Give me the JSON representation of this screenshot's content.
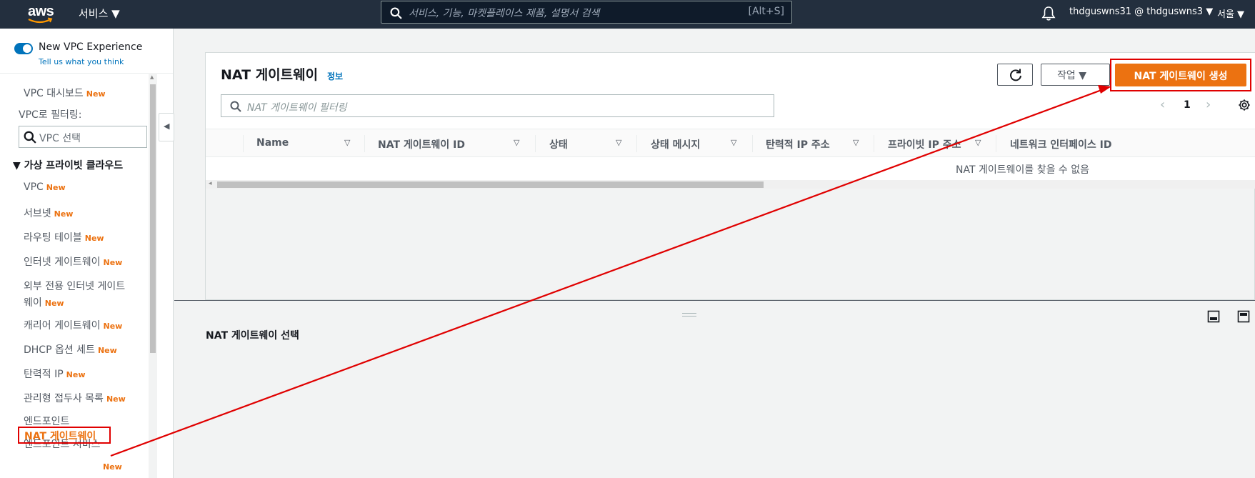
{
  "topbar": {
    "logo_text": "aws",
    "services_label": "서비스 ▼",
    "search_placeholder": "서비스, 기능, 마켓플레이스 제품, 설명서 검색",
    "search_shortcut": "[Alt+S]",
    "account": "thdguswns31 @ thdguswns3 ▼",
    "region": "서울 ▼"
  },
  "sidebar": {
    "toggle_label": "New VPC Experience",
    "feedback_link": "Tell us what you think",
    "dashboard_label": "VPC 대시보드",
    "new_badge": "New",
    "filter_label": "VPC로 필터링:",
    "vpc_select_placeholder": "VPC 선택",
    "section_title": "▼ 가상 프라이빗 클라우드",
    "items": [
      {
        "label": "VPC",
        "new": "New"
      },
      {
        "label": "서브넷",
        "new": "New"
      },
      {
        "label": "라우팅 테이블",
        "new": "New"
      },
      {
        "label": "인터넷 게이트웨이",
        "new": "New"
      },
      {
        "label": "외부 전용 인터넷 게이트",
        "label2": "웨이",
        "new": "New"
      },
      {
        "label": "캐리어 게이트웨이",
        "new": "New"
      },
      {
        "label": "DHCP 옵션 세트",
        "new": "New"
      },
      {
        "label": "탄력적 IP",
        "new": "New"
      },
      {
        "label": "관리형 접두사 목록",
        "new": "New"
      },
      {
        "label": "엔드포인트",
        "new": ""
      },
      {
        "label": "엔드포인트 서비스",
        "new": ""
      }
    ],
    "active_item": {
      "label": "NAT 게이트웨이",
      "new": "New"
    }
  },
  "main": {
    "title": "NAT 게이트웨이",
    "info_link": "정보",
    "actions_label": "작업 ▼",
    "create_button": "NAT 게이트웨이 생성",
    "filter_placeholder": "NAT 게이트웨이 필터링",
    "pager": {
      "prev": "‹",
      "page": "1",
      "next": "›"
    },
    "columns": [
      "Name",
      "NAT 게이트웨이 ID",
      "상태",
      "상태 메시지",
      "탄력적 IP 주소",
      "프라이빗 IP 주소",
      "네트워크 인터페이스 ID"
    ],
    "sort_glyph": "▽",
    "empty_text": "NAT 게이트웨이를 찾을 수 없음",
    "detail_title": "NAT 게이트웨이 선택"
  },
  "colors": {
    "topbar": "#232f3e",
    "accent_orange": "#ec7211",
    "link_blue": "#0073bb",
    "annotation_red": "#e00000"
  },
  "icons": [
    "search-icon",
    "bell-icon",
    "refresh-icon",
    "gear-icon",
    "chevron-left-icon",
    "chevron-right-icon",
    "panel-split-icon"
  ]
}
